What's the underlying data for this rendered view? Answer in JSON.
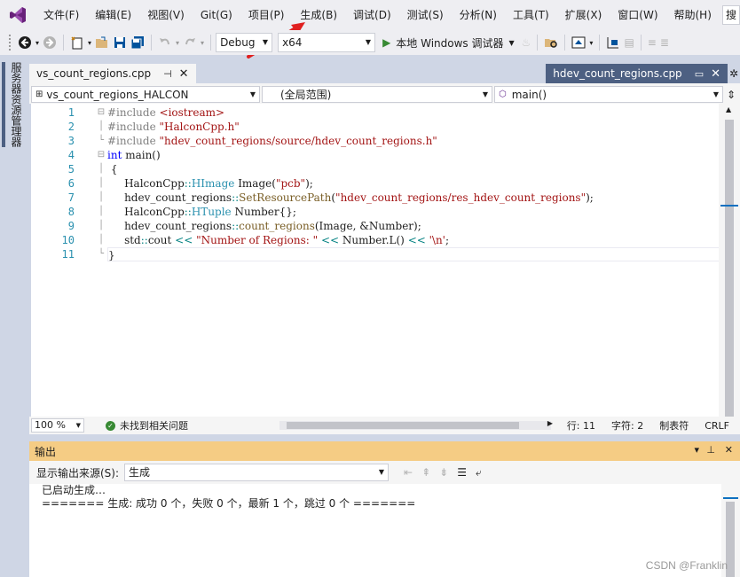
{
  "menu": {
    "items": [
      "文件(F)",
      "编辑(E)",
      "视图(V)",
      "Git(G)",
      "项目(P)",
      "生成(B)",
      "调试(D)",
      "测试(S)",
      "分析(N)",
      "工具(T)",
      "扩展(X)",
      "窗口(W)",
      "帮助(H)"
    ],
    "search_label": "搜"
  },
  "toolbar": {
    "config": "Debug",
    "platform": "x64",
    "debugger": "本地 Windows 调试器"
  },
  "left_strip": {
    "server_explorer": "服务器资源管理器"
  },
  "tabs": {
    "active": "vs_count_regions.cpp",
    "preview": "hdev_count_regions.cpp"
  },
  "navbar": {
    "project": "vs_count_regions_HALCON",
    "scope": "(全局范围)",
    "member": "main()"
  },
  "editor": {
    "line_numbers": [
      "1",
      "2",
      "3",
      "4",
      "5",
      "6",
      "7",
      "8",
      "9",
      "10",
      "11"
    ],
    "code": {
      "l1_pp": "#include ",
      "l1_str": "<iostream>",
      "l2_pp": "#include ",
      "l2_str": "\"HalconCpp.h\"",
      "l3_pp": "#include ",
      "l3_str": "\"hdev_count_regions/source/hdev_count_regions.h\"",
      "l4_kw": "int",
      "l4_rest": " main()",
      "l5": " {",
      "l6_a": "     HalconCpp",
      "l6_op": "::",
      "l6_typ": "HImage",
      "l6_b": " Image(",
      "l6_str": "\"pcb\"",
      "l6_c": ");",
      "l7_a": "     hdev_count_regions",
      "l7_op": "::",
      "l7_fn": "SetResourcePath",
      "l7_b": "(",
      "l7_str": "\"hdev_count_regions/res_hdev_count_regions\"",
      "l7_c": ");",
      "l8_a": "     HalconCpp",
      "l8_op": "::",
      "l8_typ": "HTuple",
      "l8_b": " Number{};",
      "l9_a": "     hdev_count_regions",
      "l9_op": "::",
      "l9_fn": "count_regions",
      "l9_b": "(Image, &Number);",
      "l10_a": "     std",
      "l10_op1": "::",
      "l10_b": "cout ",
      "l10_op2": "<<",
      "l10_str1": " \"Number of Regions: \"",
      "l10_op3": " <<",
      "l10_c": " Number.L() ",
      "l10_op4": "<<",
      "l10_str2": " '\\n'",
      "l10_d": ";",
      "l11": "}"
    }
  },
  "status": {
    "zoom": "100 %",
    "issues": "未找到相关问题",
    "line": "行: 11",
    "col": "字符: 2",
    "tab": "制表符",
    "eol": "CRLF"
  },
  "output": {
    "title": "输出",
    "source_label": "显示输出来源(S):",
    "source_value": "生成",
    "lines": [
      "已启动生成…",
      "======= 生成: 成功 0 个，失败 0 个，最新 1 个，跳过 0 个 ======="
    ]
  },
  "watermark": "CSDN @Franklin",
  "colors": {
    "accent": "#4d6082",
    "output_title": "#f5cc84",
    "annotation": "#e02020"
  }
}
